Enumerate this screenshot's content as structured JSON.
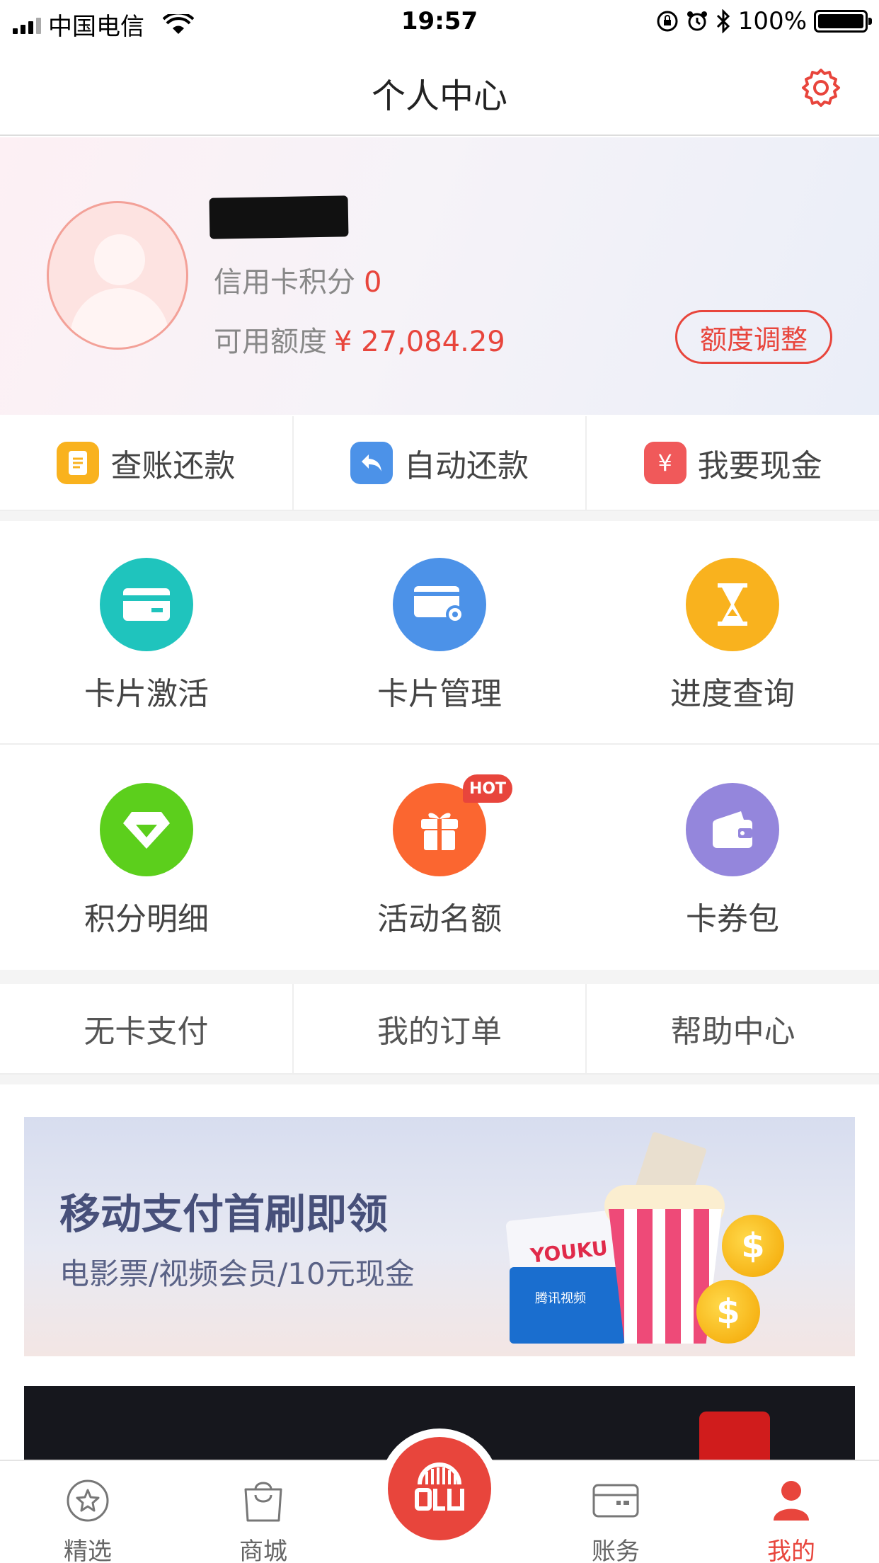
{
  "status_bar": {
    "carrier": "中国电信",
    "time": "19:57",
    "battery": "100%"
  },
  "nav": {
    "title": "个人中心"
  },
  "profile": {
    "points_label": "信用卡积分",
    "points_value": "0",
    "credit_label": "可用额度",
    "credit_value": "¥ 27,084.29",
    "adjust_label": "额度调整"
  },
  "quick_actions": [
    {
      "label": "查账还款",
      "color": "#f9b21e",
      "glyph": "≡"
    },
    {
      "label": "自动还款",
      "color": "#4c92e8",
      "glyph": "↶"
    },
    {
      "label": "我要现金",
      "color": "#f0595a",
      "glyph": "¥"
    }
  ],
  "grid_row1": [
    {
      "label": "卡片激活",
      "color": "#1fc4bd",
      "icon": "card-icon"
    },
    {
      "label": "卡片管理",
      "color": "#4c92e8",
      "icon": "card-settings-icon"
    },
    {
      "label": "进度查询",
      "color": "#f9b21e",
      "icon": "hourglass-icon"
    }
  ],
  "grid_row2": [
    {
      "label": "积分明细",
      "color": "#5ccf1c",
      "icon": "diamond-icon"
    },
    {
      "label": "活动名额",
      "color": "#fb6630",
      "icon": "gift-icon",
      "badge": "HOT"
    },
    {
      "label": "卡券包",
      "color": "#9486dc",
      "icon": "wallet-icon"
    }
  ],
  "links": [
    {
      "label": "无卡支付"
    },
    {
      "label": "我的订单"
    },
    {
      "label": "帮助中心"
    }
  ],
  "banner": {
    "headline": "移动支付首刷即领",
    "subline": "电影票/视频会员/10元现金",
    "card1_text": "YOUKU",
    "card2_text": "腾讯视频",
    "coin_symbol": "$"
  },
  "tabbar": [
    {
      "label": "精选"
    },
    {
      "label": "商城"
    },
    {
      "label": "账务"
    },
    {
      "label": "我的"
    }
  ],
  "colors": {
    "accent": "#e8453c"
  }
}
